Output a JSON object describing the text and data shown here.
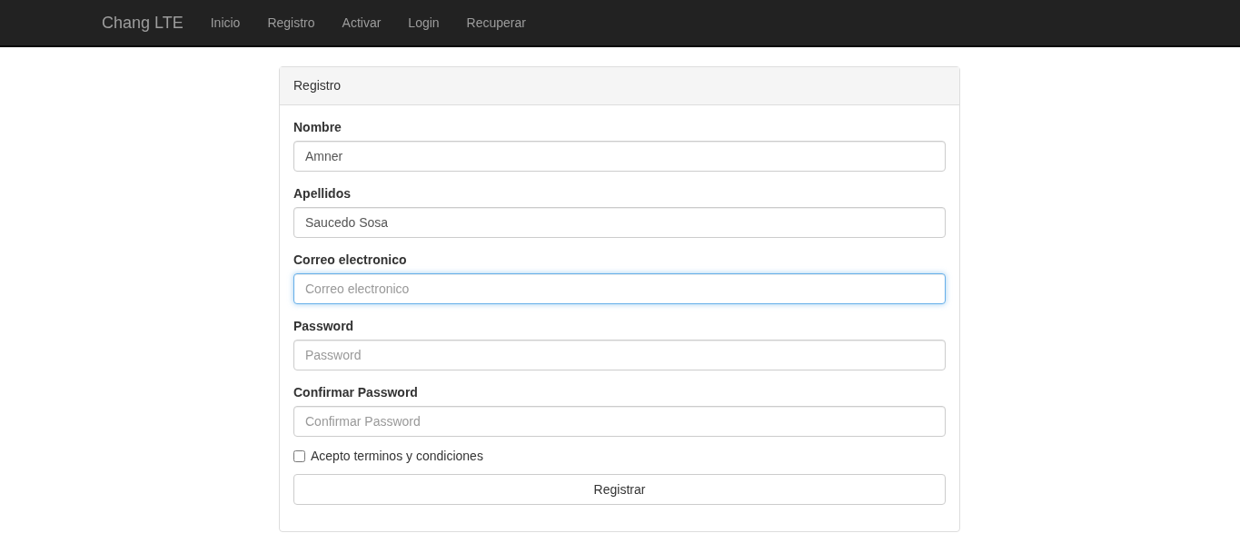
{
  "navbar": {
    "brand": "Chang LTE",
    "links": [
      {
        "label": "Inicio"
      },
      {
        "label": "Registro"
      },
      {
        "label": "Activar"
      },
      {
        "label": "Login"
      },
      {
        "label": "Recuperar"
      }
    ]
  },
  "panel": {
    "title": "Registro",
    "fields": [
      {
        "label": "Nombre",
        "value": "Amner",
        "focused": false
      },
      {
        "label": "Apellidos",
        "value": "Saucedo Sosa",
        "focused": false
      },
      {
        "label": "Correo electronico",
        "placeholder": "Correo electronico",
        "focused": true
      },
      {
        "label": "Password",
        "placeholder": "Password",
        "focused": false
      },
      {
        "label": "Confirmar Password",
        "placeholder": "Confirmar Password",
        "focused": false
      }
    ],
    "terms": {
      "label": "Acepto terminos y condiciones",
      "checked": false
    },
    "submit": "Registrar"
  }
}
